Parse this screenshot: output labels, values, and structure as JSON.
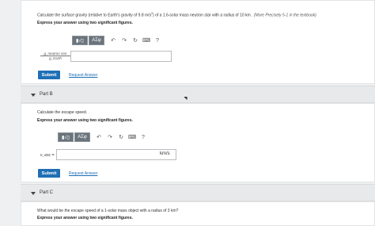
{
  "partA": {
    "question_pre": "Calculate the surface gravity (relative to Earth's gravity of 9.8 m/s",
    "question_sup": "2",
    "question_post": ") of a 1.6-solar mass neutron star with a radius of 10 km .",
    "question_hint": "(More Precisely 5-1 in the textbook)",
    "instruction": "Express your answer using two significant figures.",
    "answer_label_top": "g_neutron star",
    "answer_label_bottom": "g_Earth",
    "equals": "=",
    "submit_label": "Submit",
    "request_answer_label": "Request Answer"
  },
  "toolbar": {
    "templates_label": "▮√▯",
    "greek_label": "ΑΣφ",
    "undo_glyph": "↶",
    "redo_glyph": "↷",
    "reset_glyph": "↻",
    "keyboard_glyph": "⌨",
    "help_glyph": "?"
  },
  "partB": {
    "header": "Part B",
    "question": "Calculate the escape speed.",
    "instruction": "Express your answer using two significant figures.",
    "answer_label": "v_esc =",
    "unit": "km/s",
    "submit_label": "Submit",
    "request_answer_label": "Request Answer"
  },
  "partC": {
    "header": "Part C",
    "question": "What would be the escape speed of a 1-solar mass object with a radius of 3 km?",
    "instruction": "Express your answer using two significant figures."
  }
}
